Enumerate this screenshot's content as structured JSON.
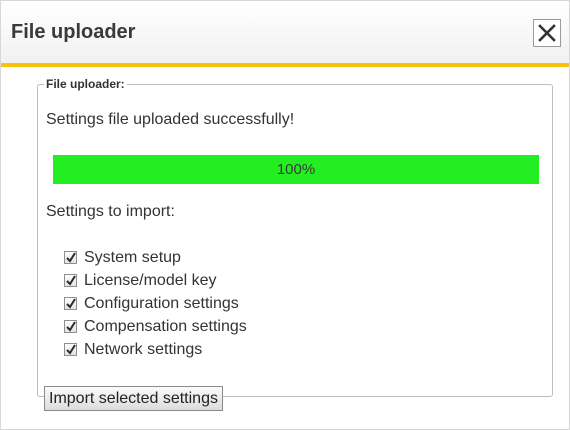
{
  "dialog": {
    "title": "File uploader",
    "close_icon": "close-icon"
  },
  "panel": {
    "legend": "File uploader:",
    "status_text": "Settings file uploaded successfully!",
    "progress": {
      "percent": 100,
      "label": "100%",
      "fill_color": "#22ee22"
    },
    "import_heading": "Settings to import:",
    "options": [
      {
        "label": "System setup",
        "checked": true
      },
      {
        "label": "License/model key",
        "checked": true
      },
      {
        "label": "Configuration settings",
        "checked": true
      },
      {
        "label": "Compensation settings",
        "checked": true
      },
      {
        "label": "Network settings",
        "checked": true
      }
    ],
    "import_button": "Import selected settings"
  },
  "colors": {
    "accent": "#f6c20a",
    "progress": "#22ee22"
  }
}
